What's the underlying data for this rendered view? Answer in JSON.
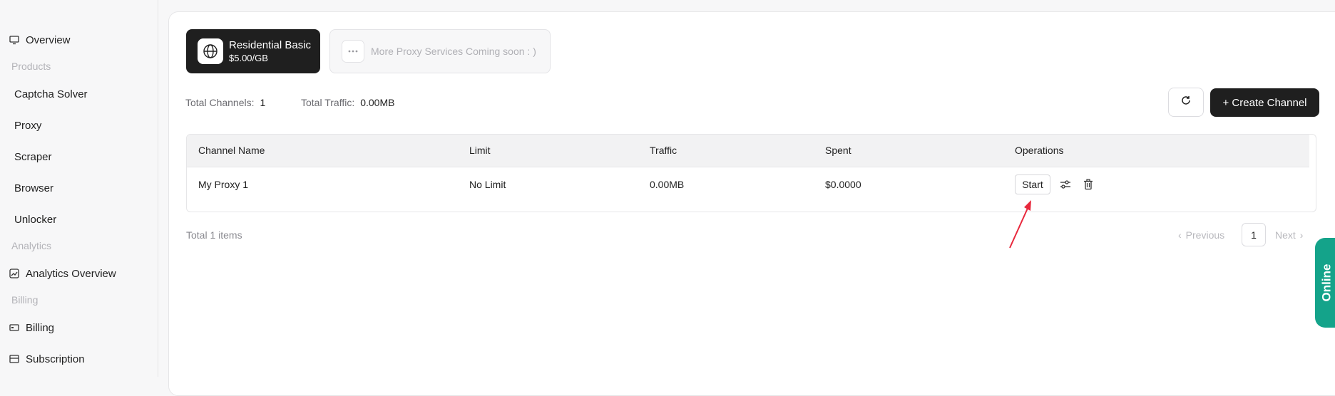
{
  "sidebar": {
    "overview": "Overview",
    "group_products": "Products",
    "captcha_solver": "Captcha Solver",
    "proxy": "Proxy",
    "scraper": "Scraper",
    "browser": "Browser",
    "unlocker": "Unlocker",
    "group_analytics": "Analytics",
    "analytics_overview": "Analytics Overview",
    "group_billing": "Billing",
    "billing": "Billing",
    "subscription": "Subscription"
  },
  "services": {
    "active": {
      "title": "Residential Basic",
      "price": "$5.00/GB",
      "icon": "globe-icon"
    },
    "soon": {
      "label": "More Proxy Services Coming soon : )",
      "icon": "more-dots-icon"
    }
  },
  "stats": {
    "channels_label": "Total Channels:",
    "channels_value": "1",
    "traffic_label": "Total Traffic:",
    "traffic_value": "0.00MB"
  },
  "toolbar": {
    "refresh_icon": "refresh-icon",
    "create_label": "+ Create Channel"
  },
  "table": {
    "columns": [
      "Channel Name",
      "Limit",
      "Traffic",
      "Spent",
      "Operations"
    ],
    "rows": [
      {
        "name": "My Proxy 1",
        "limit": "No Limit",
        "traffic": "0.00MB",
        "spent": "$0.0000",
        "start_label": "Start"
      }
    ]
  },
  "pagination": {
    "total": "Total 1 items",
    "previous": "Previous",
    "page": "1",
    "next": "Next"
  },
  "online_tab": "Online",
  "colors": {
    "accent_dark": "#1f1f1f",
    "online": "#14a38a",
    "annotation_arrow": "#e8283c"
  }
}
